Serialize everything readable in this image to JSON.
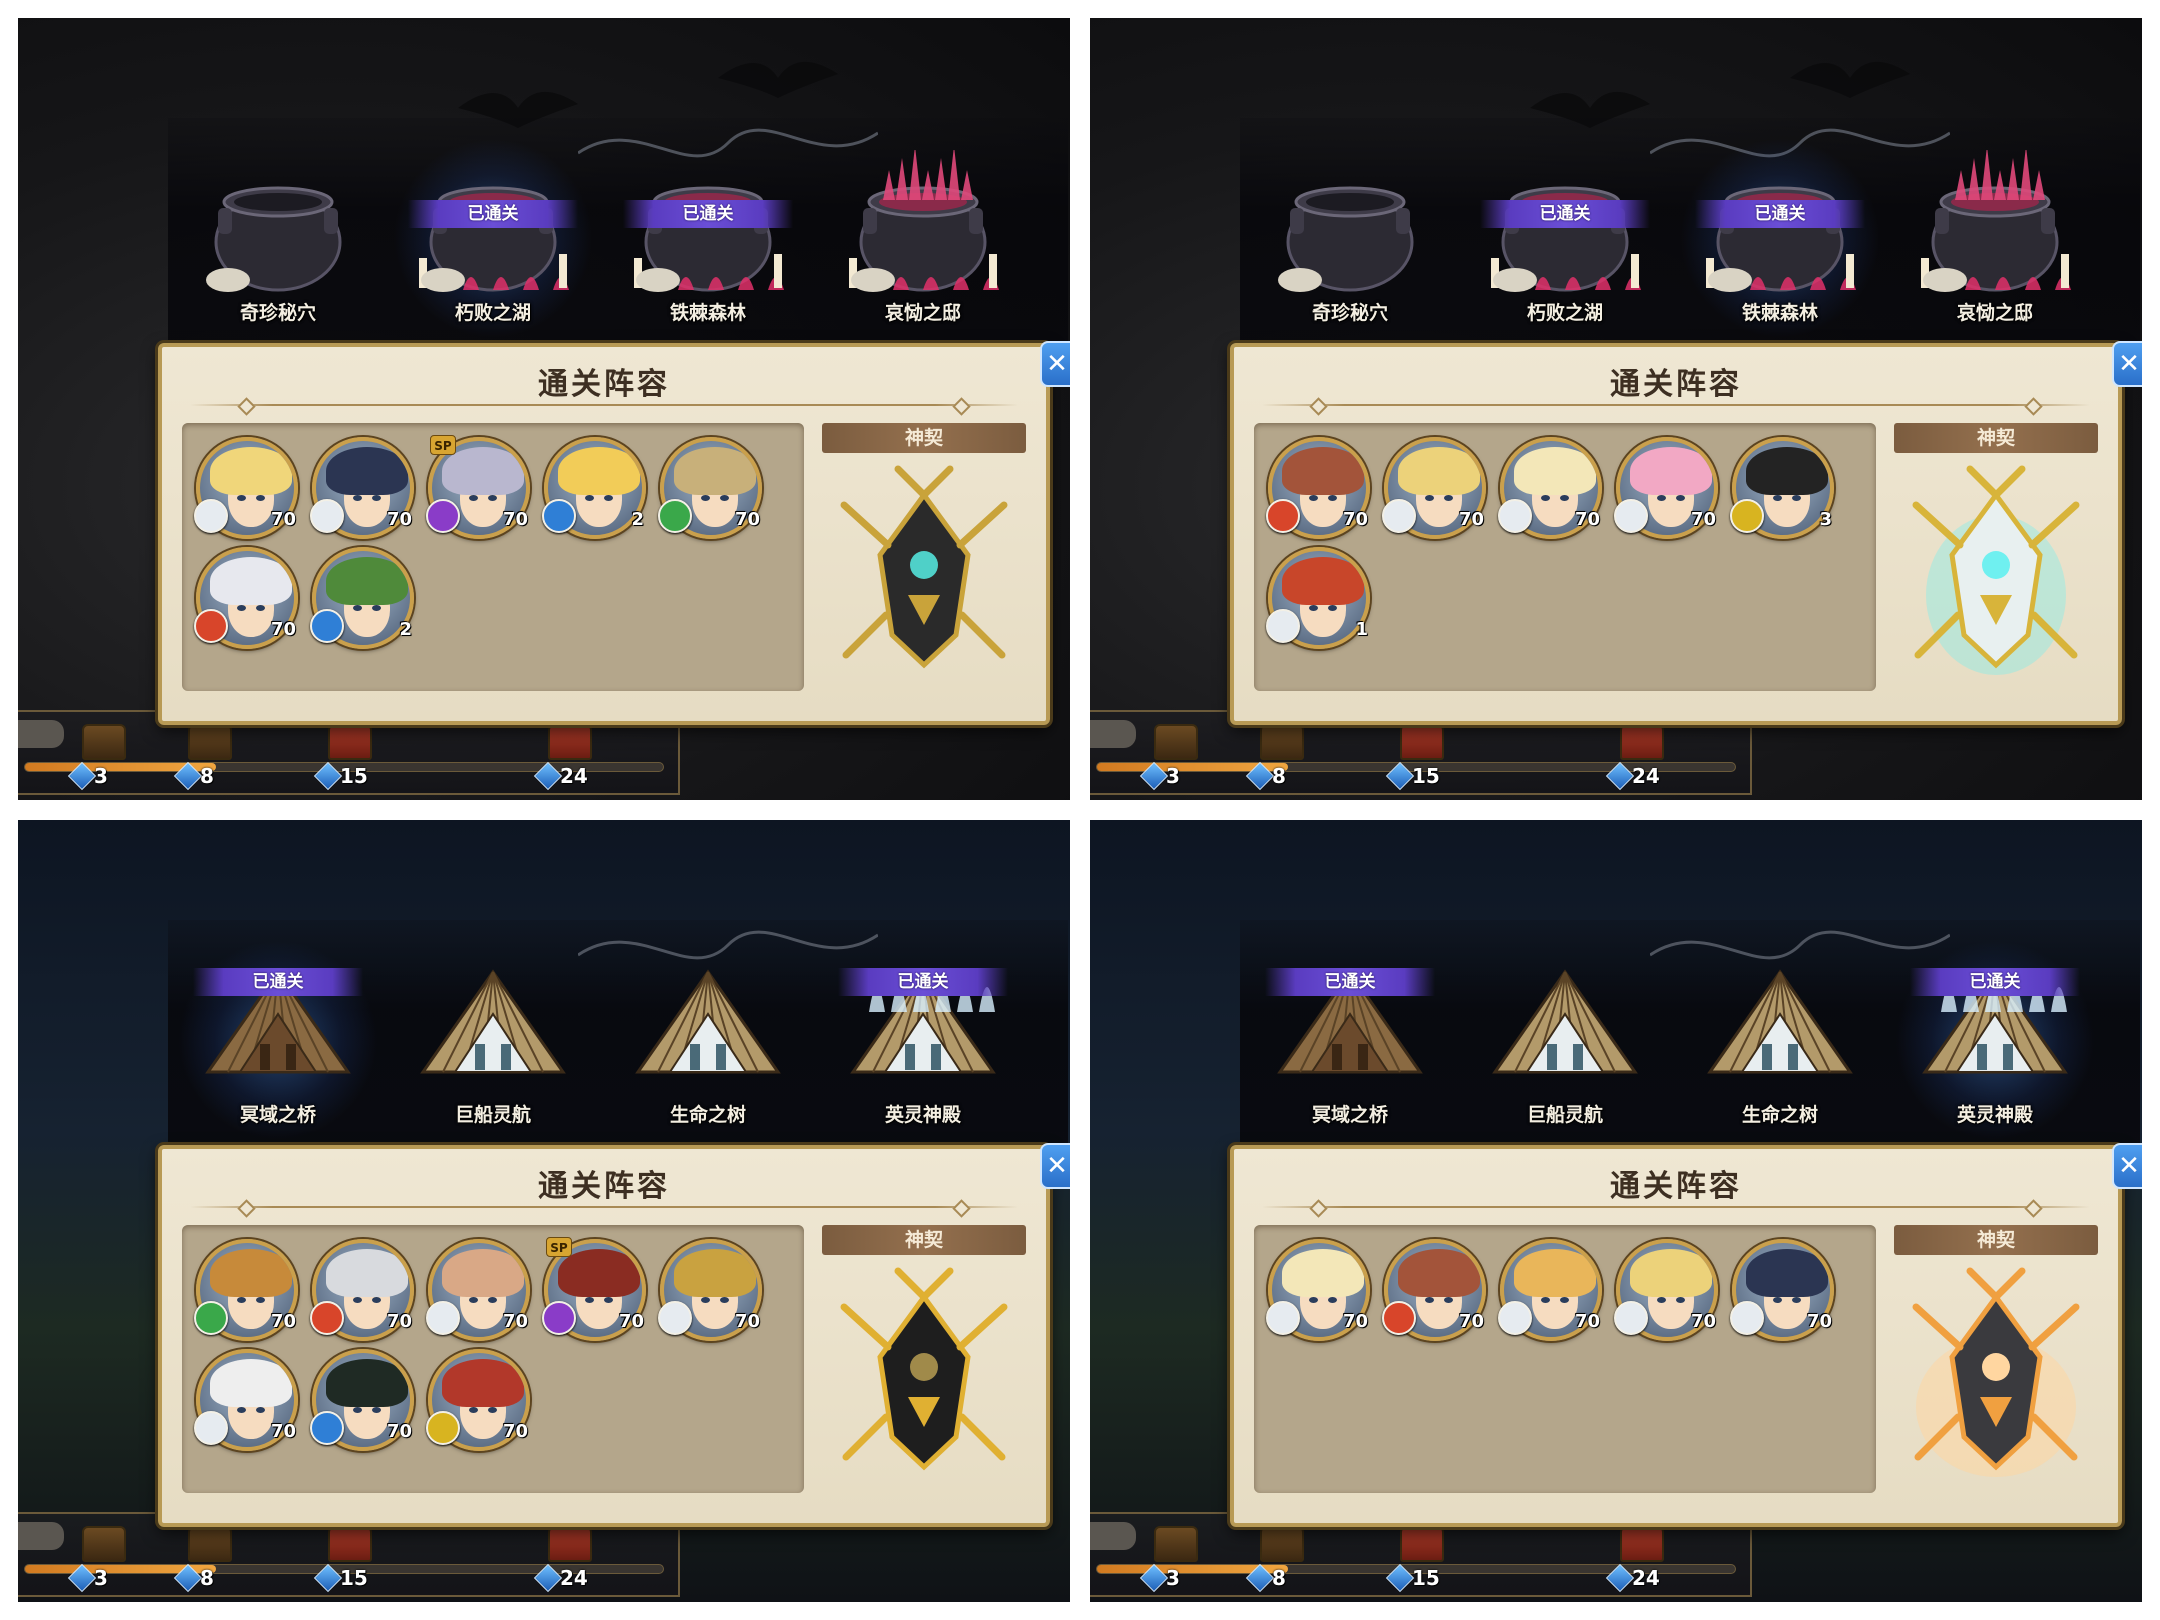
{
  "panel_title": "通关阵容",
  "pact_label": "神契",
  "close_glyph": "✕",
  "status_cleared": "已通关",
  "milestones": [
    "3",
    "8",
    "15",
    "24"
  ],
  "element_colors": {
    "water": "#2f7fd6",
    "wind": "#3aa84a",
    "light": "#e6ebf0",
    "dark": "#8a3cc8",
    "fire": "#d8452a",
    "thunder": "#d8b420"
  },
  "screens": [
    {
      "theme": "cauldron",
      "stages": [
        {
          "name": "奇珍秘穴",
          "cleared": false,
          "selected": false
        },
        {
          "name": "朽败之湖",
          "cleared": true,
          "selected": true
        },
        {
          "name": "铁棘森林",
          "cleared": true,
          "selected": false
        },
        {
          "name": "哀恸之邸",
          "cleared": false,
          "selected": false
        }
      ],
      "progress_fraction": 0.3,
      "heroes": [
        {
          "level": "70",
          "element": "light",
          "hair": "#f0d67a",
          "sp": false
        },
        {
          "level": "70",
          "element": "light",
          "hair": "#2b3552",
          "sp": false
        },
        {
          "level": "70",
          "element": "dark",
          "hair": "#b9b7cf",
          "sp": true
        },
        {
          "level": "2",
          "element": "water",
          "hair": "#f2cc58",
          "sp": false
        },
        {
          "level": "70",
          "element": "wind",
          "hair": "#c8b07a",
          "sp": false
        },
        {
          "level": "70",
          "element": "fire",
          "hair": "#e7e8ee",
          "sp": false
        },
        {
          "level": "2",
          "element": "water",
          "hair": "#4f8a3a",
          "sp": false
        }
      ],
      "pact_beast": "gold-dark"
    },
    {
      "theme": "cauldron",
      "stages": [
        {
          "name": "奇珍秘穴",
          "cleared": false,
          "selected": false
        },
        {
          "name": "朽败之湖",
          "cleared": true,
          "selected": false
        },
        {
          "name": "铁棘森林",
          "cleared": true,
          "selected": true
        },
        {
          "name": "哀恸之邸",
          "cleared": false,
          "selected": false
        }
      ],
      "progress_fraction": 0.3,
      "heroes": [
        {
          "level": "70",
          "element": "fire",
          "hair": "#a3543a",
          "sp": false
        },
        {
          "level": "70",
          "element": "light",
          "hair": "#ecd27a",
          "sp": false
        },
        {
          "level": "70",
          "element": "light",
          "hair": "#f3e7b8",
          "sp": false
        },
        {
          "level": "70",
          "element": "light",
          "hair": "#f2a8c4",
          "sp": false
        },
        {
          "level": "3",
          "element": "thunder",
          "hair": "#232323",
          "sp": false
        },
        {
          "level": "1",
          "element": "light",
          "hair": "#c8462a",
          "sp": false
        }
      ],
      "pact_beast": "gold-cyan"
    },
    {
      "theme": "house",
      "stages": [
        {
          "name": "冥域之桥",
          "cleared": true,
          "selected": true
        },
        {
          "name": "巨船灵航",
          "cleared": false,
          "selected": false
        },
        {
          "name": "生命之树",
          "cleared": false,
          "selected": false
        },
        {
          "name": "英灵神殿",
          "cleared": true,
          "selected": false
        }
      ],
      "progress_fraction": 0.3,
      "heroes": [
        {
          "level": "70",
          "element": "wind",
          "hair": "#c78a3a",
          "sp": false
        },
        {
          "level": "70",
          "element": "fire",
          "hair": "#d8dade",
          "sp": false
        },
        {
          "level": "70",
          "element": "light",
          "hair": "#d9a886",
          "sp": false
        },
        {
          "level": "70",
          "element": "dark",
          "hair": "#8a2c22",
          "sp": true
        },
        {
          "level": "70",
          "element": "light",
          "hair": "#c9a240",
          "sp": false
        },
        {
          "level": "70",
          "element": "light",
          "hair": "#eeeeee",
          "sp": false
        },
        {
          "level": "70",
          "element": "water",
          "hair": "#1f2a24",
          "sp": false
        },
        {
          "level": "70",
          "element": "thunder",
          "hair": "#b2382a",
          "sp": false
        }
      ],
      "pact_beast": "gold-black"
    },
    {
      "theme": "house",
      "stages": [
        {
          "name": "冥域之桥",
          "cleared": true,
          "selected": false
        },
        {
          "name": "巨船灵航",
          "cleared": false,
          "selected": false
        },
        {
          "name": "生命之树",
          "cleared": false,
          "selected": false
        },
        {
          "name": "英灵神殿",
          "cleared": true,
          "selected": true
        }
      ],
      "progress_fraction": 0.3,
      "heroes": [
        {
          "level": "70",
          "element": "light",
          "hair": "#f3e7b8",
          "sp": false
        },
        {
          "level": "70",
          "element": "fire",
          "hair": "#a3543a",
          "sp": false
        },
        {
          "level": "70",
          "element": "light",
          "hair": "#e9b65a",
          "sp": false
        },
        {
          "level": "70",
          "element": "light",
          "hair": "#ecd27a",
          "sp": false
        },
        {
          "level": "70",
          "element": "light",
          "hair": "#2b3552",
          "sp": false
        }
      ],
      "pact_beast": "flame-dragon"
    }
  ]
}
